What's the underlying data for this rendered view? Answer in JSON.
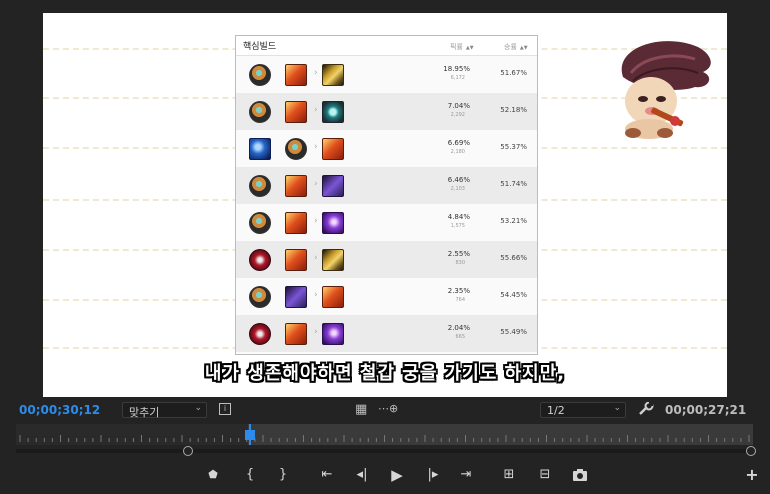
{
  "build_table": {
    "title": "핵심빌드",
    "col_pick": "픽률",
    "col_winrate": "승률",
    "rows": [
      {
        "items": [
          "orb",
          "orange",
          "gold"
        ],
        "pick": "18.95%",
        "games": "6,172",
        "winrate": "51.67%"
      },
      {
        "items": [
          "orb",
          "orange",
          "teal"
        ],
        "pick": "7.04%",
        "games": "2,292",
        "winrate": "52.18%"
      },
      {
        "items": [
          "blue",
          "orb",
          "orange"
        ],
        "pick": "6.69%",
        "games": "2,180",
        "winrate": "55.37%"
      },
      {
        "items": [
          "orb",
          "orange",
          "purple"
        ],
        "pick": "6.46%",
        "games": "2,103",
        "winrate": "51.74%"
      },
      {
        "items": [
          "orb",
          "orange",
          "violet"
        ],
        "pick": "4.84%",
        "games": "1,575",
        "winrate": "53.21%"
      },
      {
        "items": [
          "red",
          "orange",
          "gold"
        ],
        "pick": "2.55%",
        "games": "830",
        "winrate": "55.66%"
      },
      {
        "items": [
          "orb",
          "purple",
          "orange"
        ],
        "pick": "2.35%",
        "games": "764",
        "winrate": "54.45%"
      },
      {
        "items": [
          "red",
          "orange",
          "violet"
        ],
        "pick": "2.04%",
        "games": "665",
        "winrate": "55.49%"
      }
    ]
  },
  "subtitle": "내가 생존해야하면 철갑 궁을 가기도 하지만,",
  "controls": {
    "timecode_current": "00;00;30;12",
    "timecode_duration": "00;00;27;21",
    "fit_label": "맞추기",
    "resolution_label": "1/2"
  },
  "icons": {
    "settings": "settings-icon",
    "export_frame": "camera-icon",
    "add": "plus-icon"
  },
  "colors": {
    "accent": "#2d8ceb",
    "background": "#232323"
  }
}
